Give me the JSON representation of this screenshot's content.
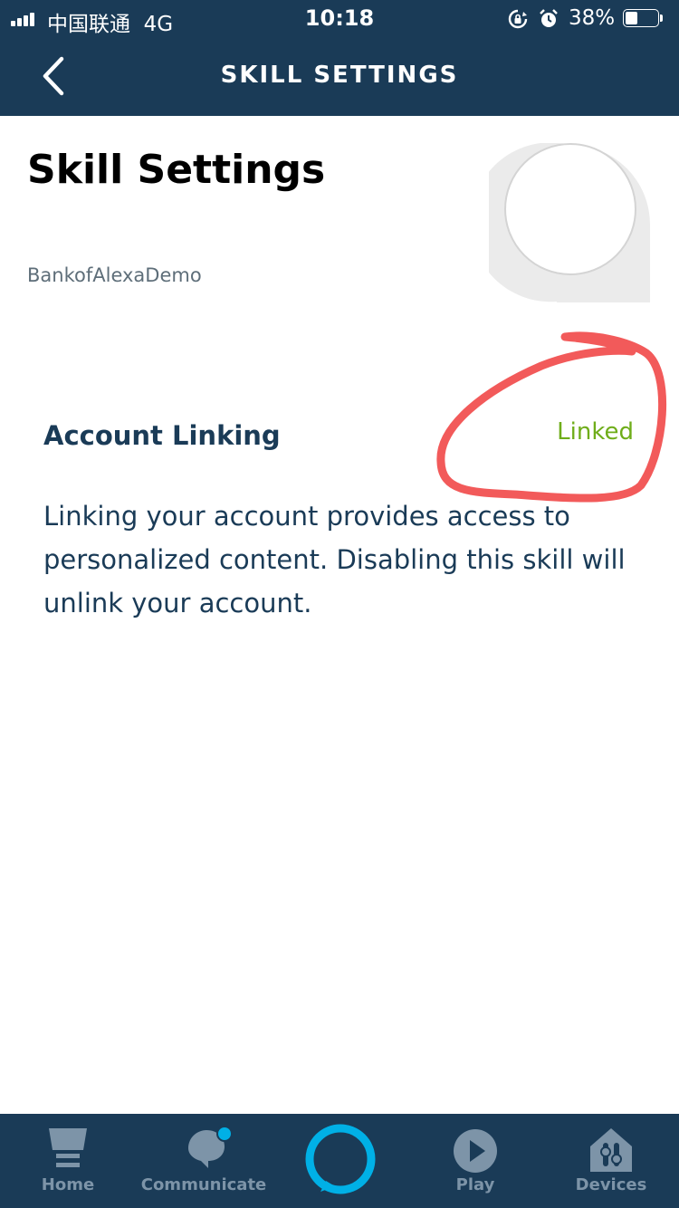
{
  "status_bar": {
    "carrier": "中国联通",
    "network": "4G",
    "time": "10:18",
    "battery": "38%",
    "battery_level": 0.38
  },
  "header": {
    "title": "SKILL SETTINGS",
    "back_icon": "chevron-left-icon"
  },
  "page": {
    "title": "Skill Settings",
    "skill_name": "BankofAlexaDemo",
    "skill_icon": "skill-placeholder-icon"
  },
  "account_linking": {
    "heading": "Account Linking",
    "status": "Linked",
    "status_color": "#6fad1a",
    "annotation_color": "#f25a5a",
    "description": "Linking your account provides access to personalized content. Disabling this skill will unlink your account."
  },
  "tabbar": {
    "tabs": [
      {
        "label": "Home",
        "icon": "home-icon"
      },
      {
        "label": "Communicate",
        "icon": "chat-bubble-icon"
      },
      {
        "label": "",
        "icon": "alexa-ring-icon"
      },
      {
        "label": "Play",
        "icon": "play-icon"
      },
      {
        "label": "Devices",
        "icon": "devices-icon"
      }
    ]
  },
  "colors": {
    "header_bg": "#1a3b57",
    "tab_inactive": "#7d94a8",
    "alexa_accent": "#00b0e6"
  }
}
